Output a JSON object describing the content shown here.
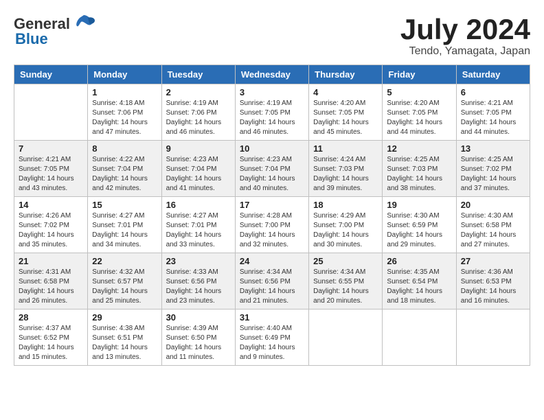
{
  "logo": {
    "text_general": "General",
    "text_blue": "Blue"
  },
  "header": {
    "month_year": "July 2024",
    "location": "Tendo, Yamagata, Japan"
  },
  "days_of_week": [
    "Sunday",
    "Monday",
    "Tuesday",
    "Wednesday",
    "Thursday",
    "Friday",
    "Saturday"
  ],
  "weeks": [
    [
      {
        "day": "",
        "info": ""
      },
      {
        "day": "1",
        "info": "Sunrise: 4:18 AM\nSunset: 7:06 PM\nDaylight: 14 hours\nand 47 minutes."
      },
      {
        "day": "2",
        "info": "Sunrise: 4:19 AM\nSunset: 7:06 PM\nDaylight: 14 hours\nand 46 minutes."
      },
      {
        "day": "3",
        "info": "Sunrise: 4:19 AM\nSunset: 7:05 PM\nDaylight: 14 hours\nand 46 minutes."
      },
      {
        "day": "4",
        "info": "Sunrise: 4:20 AM\nSunset: 7:05 PM\nDaylight: 14 hours\nand 45 minutes."
      },
      {
        "day": "5",
        "info": "Sunrise: 4:20 AM\nSunset: 7:05 PM\nDaylight: 14 hours\nand 44 minutes."
      },
      {
        "day": "6",
        "info": "Sunrise: 4:21 AM\nSunset: 7:05 PM\nDaylight: 14 hours\nand 44 minutes."
      }
    ],
    [
      {
        "day": "7",
        "info": "Sunrise: 4:21 AM\nSunset: 7:05 PM\nDaylight: 14 hours\nand 43 minutes."
      },
      {
        "day": "8",
        "info": "Sunrise: 4:22 AM\nSunset: 7:04 PM\nDaylight: 14 hours\nand 42 minutes."
      },
      {
        "day": "9",
        "info": "Sunrise: 4:23 AM\nSunset: 7:04 PM\nDaylight: 14 hours\nand 41 minutes."
      },
      {
        "day": "10",
        "info": "Sunrise: 4:23 AM\nSunset: 7:04 PM\nDaylight: 14 hours\nand 40 minutes."
      },
      {
        "day": "11",
        "info": "Sunrise: 4:24 AM\nSunset: 7:03 PM\nDaylight: 14 hours\nand 39 minutes."
      },
      {
        "day": "12",
        "info": "Sunrise: 4:25 AM\nSunset: 7:03 PM\nDaylight: 14 hours\nand 38 minutes."
      },
      {
        "day": "13",
        "info": "Sunrise: 4:25 AM\nSunset: 7:02 PM\nDaylight: 14 hours\nand 37 minutes."
      }
    ],
    [
      {
        "day": "14",
        "info": "Sunrise: 4:26 AM\nSunset: 7:02 PM\nDaylight: 14 hours\nand 35 minutes."
      },
      {
        "day": "15",
        "info": "Sunrise: 4:27 AM\nSunset: 7:01 PM\nDaylight: 14 hours\nand 34 minutes."
      },
      {
        "day": "16",
        "info": "Sunrise: 4:27 AM\nSunset: 7:01 PM\nDaylight: 14 hours\nand 33 minutes."
      },
      {
        "day": "17",
        "info": "Sunrise: 4:28 AM\nSunset: 7:00 PM\nDaylight: 14 hours\nand 32 minutes."
      },
      {
        "day": "18",
        "info": "Sunrise: 4:29 AM\nSunset: 7:00 PM\nDaylight: 14 hours\nand 30 minutes."
      },
      {
        "day": "19",
        "info": "Sunrise: 4:30 AM\nSunset: 6:59 PM\nDaylight: 14 hours\nand 29 minutes."
      },
      {
        "day": "20",
        "info": "Sunrise: 4:30 AM\nSunset: 6:58 PM\nDaylight: 14 hours\nand 27 minutes."
      }
    ],
    [
      {
        "day": "21",
        "info": "Sunrise: 4:31 AM\nSunset: 6:58 PM\nDaylight: 14 hours\nand 26 minutes."
      },
      {
        "day": "22",
        "info": "Sunrise: 4:32 AM\nSunset: 6:57 PM\nDaylight: 14 hours\nand 25 minutes."
      },
      {
        "day": "23",
        "info": "Sunrise: 4:33 AM\nSunset: 6:56 PM\nDaylight: 14 hours\nand 23 minutes."
      },
      {
        "day": "24",
        "info": "Sunrise: 4:34 AM\nSunset: 6:56 PM\nDaylight: 14 hours\nand 21 minutes."
      },
      {
        "day": "25",
        "info": "Sunrise: 4:34 AM\nSunset: 6:55 PM\nDaylight: 14 hours\nand 20 minutes."
      },
      {
        "day": "26",
        "info": "Sunrise: 4:35 AM\nSunset: 6:54 PM\nDaylight: 14 hours\nand 18 minutes."
      },
      {
        "day": "27",
        "info": "Sunrise: 4:36 AM\nSunset: 6:53 PM\nDaylight: 14 hours\nand 16 minutes."
      }
    ],
    [
      {
        "day": "28",
        "info": "Sunrise: 4:37 AM\nSunset: 6:52 PM\nDaylight: 14 hours\nand 15 minutes."
      },
      {
        "day": "29",
        "info": "Sunrise: 4:38 AM\nSunset: 6:51 PM\nDaylight: 14 hours\nand 13 minutes."
      },
      {
        "day": "30",
        "info": "Sunrise: 4:39 AM\nSunset: 6:50 PM\nDaylight: 14 hours\nand 11 minutes."
      },
      {
        "day": "31",
        "info": "Sunrise: 4:40 AM\nSunset: 6:49 PM\nDaylight: 14 hours\nand 9 minutes."
      },
      {
        "day": "",
        "info": ""
      },
      {
        "day": "",
        "info": ""
      },
      {
        "day": "",
        "info": ""
      }
    ]
  ]
}
